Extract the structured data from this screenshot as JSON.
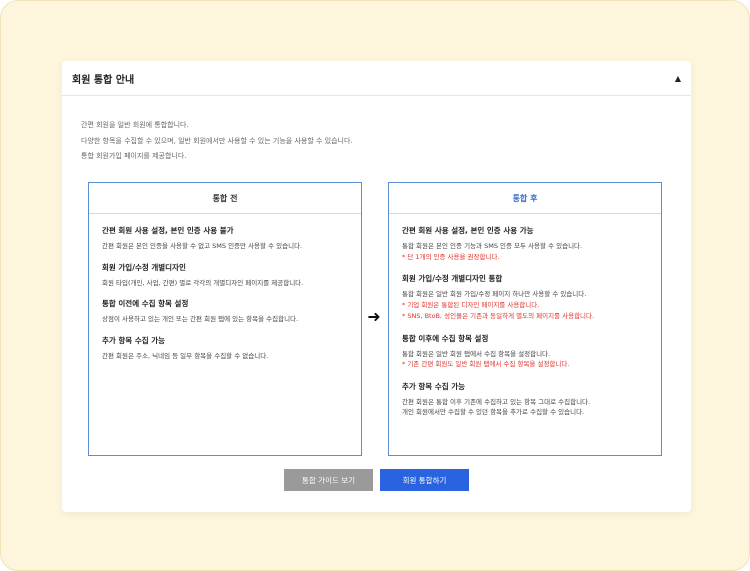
{
  "card": {
    "title": "회원 통합 안내",
    "collapse_icon": "▲"
  },
  "intro": [
    "간편 회원을 일반 회원에 통합합니다.",
    "다양한 항목을 수집할 수 있으며, 일반 회원에서만 사용할 수 있는 기능을 사용할 수 있습니다.",
    "통합 회원가입 페이지를 제공합니다."
  ],
  "before": {
    "heading": "통합 전",
    "features": [
      {
        "title": "간편 회원 사용 설정, 본인 인증 사용 불가",
        "lines": [
          "간편 회원은 본인 인증을 사용할 수 없고 SMS 인증만 사용할 수 있습니다."
        ],
        "notes": []
      },
      {
        "title": "회원 가입/수정 개별디자인",
        "lines": [
          "회원 타입(개인, 사업, 간편) 별로 각각의 개별디자인 페이지를 제공합니다."
        ],
        "notes": []
      },
      {
        "title": "통합 이전에 수집 항목 설정",
        "lines": [
          "상점이 사용하고 있는 개인 또는 간편 회원 탭에 있는 항목을 수집합니다."
        ],
        "notes": []
      },
      {
        "title": "추가 항목 수집 가능",
        "lines": [
          "간편 회원은 주소, 닉네임 등 일부 항목을 수집할 수 없습니다."
        ],
        "notes": []
      }
    ]
  },
  "after": {
    "heading": "통합 후",
    "features": [
      {
        "title": "간편 회원 사용 설정, 본인 인증 사용 가능",
        "lines": [
          "통합 회원은 본인 인증 기능과 SMS 인증 모두 사용할 수 있습니다."
        ],
        "notes": [
          "* 단 1개의 인증 사용을 권장합니다."
        ]
      },
      {
        "title": "회원 가입/수정 개별디자인 통합",
        "lines": [
          "통합 회원은 일반 회원 가입/수정 페이지 하나만 사용할 수 있습니다."
        ],
        "notes": [
          "* 기업 회원은 통합된 디자인 페이지를 사용합니다.",
          "* SNS, BtoB, 성인몰은 기존과 동일하게 별도의 페이지를 사용합니다."
        ]
      },
      {
        "title": "통합 이후에 수집 항목 설정",
        "lines": [
          "통합 회원은 일반 회원 탭에서 수집 항목을 설정합니다."
        ],
        "notes": [
          "* 기존 간편 회원도 일반 회원 탭에서 수집 항목을 설정합니다."
        ]
      },
      {
        "title": "추가 항목 수집 가능",
        "lines": [
          "간편 회원은 통합 이후 기존에 수집하고 있는 항목 그대로 수집합니다.",
          "개인 회원에서만 수집할 수 있던 항목을 추가로 수집할 수 있습니다."
        ],
        "notes": []
      }
    ]
  },
  "arrow_icon": "➜",
  "buttons": {
    "guide": "통합 가이드 보기",
    "merge": "회원 통합하기"
  },
  "colors": {
    "frame_bg": "#fdf6dc",
    "panel_border": "#5b8fd1",
    "after_heading": "#3a6fc4",
    "note_red": "#e0312b",
    "guide_button": "#9a9a9a",
    "merge_button": "#2a63e0"
  }
}
